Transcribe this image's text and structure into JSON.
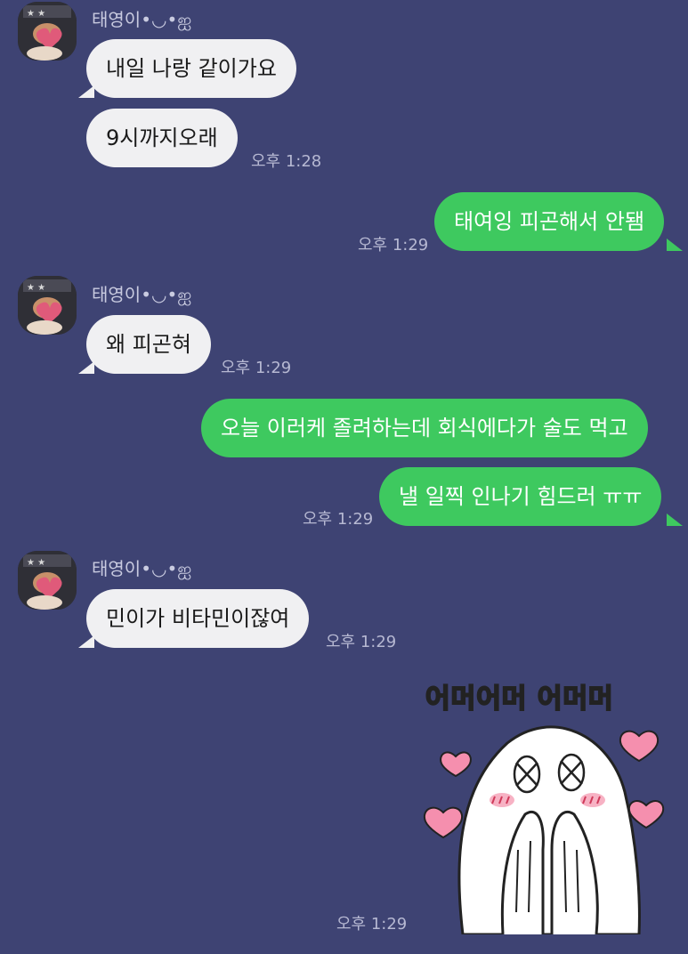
{
  "chat": {
    "sender_name": "태영이•◡•ஐ",
    "messages": [
      {
        "text": "내일 나랑 같이가요"
      },
      {
        "text": "9시까지오래",
        "time": "오후 1:28"
      },
      {
        "text": "태여잉 피곤해서 안됌",
        "time": "오후 1:29"
      },
      {
        "text": "왜 피곤혀",
        "time": "오후 1:29"
      },
      {
        "text": "오늘 이러케 졸려하는데 회식에다가 술도 먹고"
      },
      {
        "text": "낼 일찍 인나기 힘드러 ㅠㅠ",
        "time": "오후 1:29"
      },
      {
        "text": "민이가 비타민이잖여",
        "time": "오후 1:29"
      }
    ],
    "sticker": {
      "caption": "어머어머 어머머",
      "time": "오후 1:29",
      "icon": "blushing-ghost-sticker"
    }
  },
  "colors": {
    "background": "#3e4373",
    "incoming_bubble": "#f0f0f2",
    "outgoing_bubble": "#3ec95f",
    "heart": "#f58fae"
  }
}
